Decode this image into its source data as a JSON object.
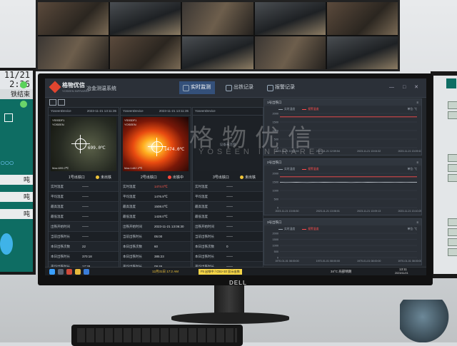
{
  "left_monitor": {
    "clock": [
      "11/21",
      "2:36"
    ],
    "label_end": "铁结束",
    "unit_labels": [
      "吨",
      "吨",
      "吨"
    ]
  },
  "app": {
    "brand": "格物优信",
    "brand_sub": "YOSEEN INFRARED",
    "system_title": "冶金测温系统",
    "tabs": [
      "实时监测",
      "出铁记录",
      "报警记录"
    ],
    "window_buttons": "— □ ✕"
  },
  "watermark": {
    "text": "格物优信",
    "sub": "YOSEEN INFRARED"
  },
  "panels": [
    {
      "device": "YoseenDevice",
      "time": "2023-11-21 13:11:35",
      "thermal_name": "YS93DF1",
      "thermal_name2": "YOSEEN",
      "temp_reading": "699.0℃",
      "thermal_status": "Max:699.0℃",
      "title": "1号出铁口",
      "status": "未出铁",
      "status_color": "#f0c53a",
      "rows": [
        {
          "k": "实时温度",
          "v": "——"
        },
        {
          "k": "平均温度",
          "v": "——"
        },
        {
          "k": "最高温度",
          "v": "——"
        },
        {
          "k": "最低温度",
          "v": "——"
        },
        {
          "k": "出铁开始时间",
          "v": "——"
        },
        {
          "k": "当前出铁时长",
          "v": "——"
        },
        {
          "k": "本日出铁次数",
          "v": "22"
        },
        {
          "k": "本日出铁时长",
          "v": "370:18"
        },
        {
          "k": "平均出铁时长",
          "v": "17:28"
        },
        {
          "k": "上次出铁时间",
          "v": "2023-11-21 11:21:14"
        },
        {
          "k": "累计出铁次数",
          "v": "57"
        },
        {
          "k": "累计出铁时长",
          "v": "0998"
        }
      ]
    },
    {
      "device": "YoseenDevice",
      "time": "2023-11-21 13:11:35",
      "thermal_name": "YS93DF1",
      "thermal_name2": "YOSEEN",
      "temp_reading": "1474.0℃",
      "thermal_status": "Max:1482.3℃",
      "title": "2号出铁口",
      "status": "出铁中",
      "status_color": "#ff4a3d",
      "rows": [
        {
          "k": "实时温度",
          "v": "1474.0℃",
          "red": true
        },
        {
          "k": "平均温度",
          "v": "1476.9℃"
        },
        {
          "k": "最高温度",
          "v": "1508.0℃"
        },
        {
          "k": "最低温度",
          "v": "1428.0℃"
        },
        {
          "k": "出铁开始时间",
          "v": "2023-11-21 13:06:30"
        },
        {
          "k": "当前出铁时长",
          "v": "05:00"
        },
        {
          "k": "本日出铁次数",
          "v": "60"
        },
        {
          "k": "本日出铁时长",
          "v": "385:23"
        },
        {
          "k": "平均出铁时长",
          "v": "09:46"
        },
        {
          "k": "上次出铁时间",
          "v": "2023-11-21 12:06:43"
        },
        {
          "k": "累计出铁次数",
          "v": "57"
        },
        {
          "k": "累计出铁时长",
          "v": "6002"
        }
      ]
    },
    {
      "device": "YoseenDevice",
      "time": "",
      "thermal_name": "",
      "thermal_name2": "",
      "temp_reading": "",
      "thermal_status": "",
      "thermal_center": "设备未连接",
      "title": "3号出铁口",
      "status": "未出铁",
      "status_color": "#f0c53a",
      "rows": [
        {
          "k": "实时温度",
          "v": "——"
        },
        {
          "k": "平均温度",
          "v": "——"
        },
        {
          "k": "最高温度",
          "v": "——"
        },
        {
          "k": "最低温度",
          "v": "——"
        },
        {
          "k": "出铁开始时间",
          "v": "——"
        },
        {
          "k": "当前出铁时长",
          "v": "——"
        },
        {
          "k": "本日出铁次数",
          "v": "0"
        },
        {
          "k": "本日出铁时长",
          "v": "——"
        },
        {
          "k": "平均出铁时长",
          "v": "——"
        },
        {
          "k": "上次出铁时间",
          "v": "——"
        },
        {
          "k": "累计出铁次数",
          "v": "0"
        },
        {
          "k": "累计出铁时长",
          "v": "0"
        }
      ]
    }
  ],
  "charts": [
    {
      "title": "1号出铁口",
      "unit": "单位: ℃",
      "legend": [
        "实时温度",
        "报警温度"
      ],
      "yticks": [
        "2000",
        "1500",
        "1000",
        "500",
        "0"
      ],
      "xticks": [
        "2023-11-21 12:55:16",
        "2023-11-21 12:59:54",
        "2023-11-21 13:04:32",
        "2023-11-21 13:09:10"
      ],
      "alarm_y": 1800,
      "series": []
    },
    {
      "title": "2号出铁口",
      "unit": "单位: ℃",
      "legend": [
        "实时温度",
        "报警温度"
      ],
      "yticks": [
        "2000",
        "1500",
        "1000",
        "500",
        "0"
      ],
      "xticks": [
        "2023-11-21 13:06:50",
        "2023-11-21 13:08:01",
        "2023-11-21 13:09:13",
        "2023-11-21 13:10:25"
      ],
      "alarm_y": 1800,
      "series": [
        1480,
        1465,
        1470,
        1478,
        1472,
        1466,
        1474,
        1469,
        1481,
        1475,
        1470,
        1477,
        1473,
        1468,
        1476,
        1471,
        1479,
        1474,
        1470,
        1476,
        1473,
        1469,
        1475,
        1472,
        1477,
        1474
      ]
    },
    {
      "title": "3号出铁口",
      "unit": "单位: ℃",
      "legend": [
        "实时温度",
        "报警温度"
      ],
      "yticks": [
        "2000",
        "1500",
        "1000",
        "500",
        "0"
      ],
      "xticks": [
        "1970-01-01 08:00:00",
        "1970-01-01 08:00:00",
        "1970-01-01 08:00:00",
        "1970-01-01 08:00:00"
      ],
      "alarm_y": null,
      "series": []
    }
  ],
  "taskbar": {
    "notify_prefix": "12月31日 17:2 AM",
    "notify": "F5 出铁中 / C51+10 显示出铁",
    "weather": "34°C 局部晴朗",
    "time": "13:11",
    "date": "2023/11/21"
  },
  "monitor_brand": "DELL"
}
